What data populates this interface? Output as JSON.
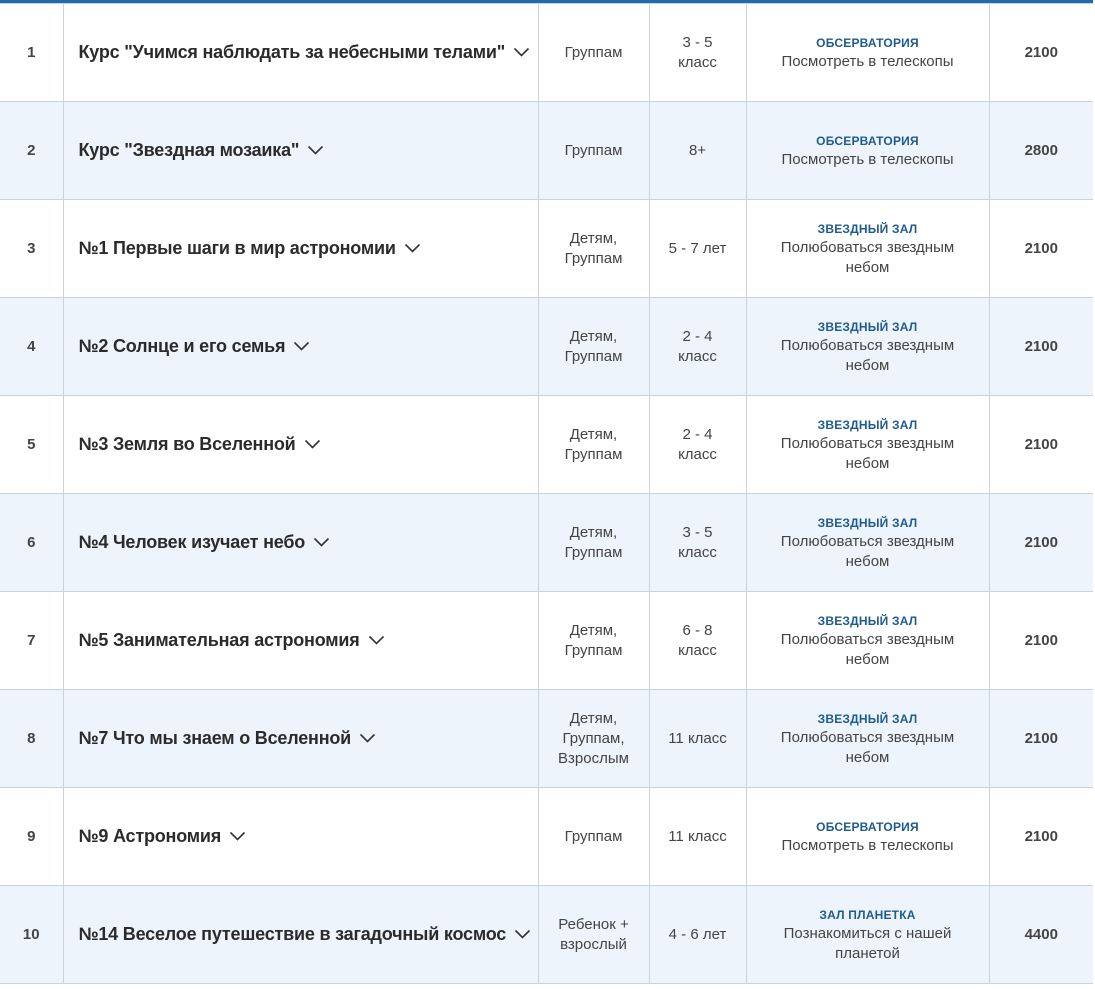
{
  "colors": {
    "accent_bar": "#1e6bb0",
    "price": "#3cb6a6",
    "hall_name": "#1f5b8e",
    "row_alt_bg": "#eef4fb",
    "border": "#c9d3de"
  },
  "icons": {
    "expand": "chevron-down-icon"
  },
  "rows": [
    {
      "num": "1",
      "title": "Курс \"Учимся наблюдать за небесными телами\"",
      "audience": [
        "Группам"
      ],
      "age": [
        "3 - 5",
        "класс"
      ],
      "hall_name": "ОБСЕРВАТОРИЯ",
      "hall_desc": [
        "Посмотреть в телескопы"
      ],
      "price": "2100"
    },
    {
      "num": "2",
      "title": "Курс \"Звездная мозаика\"",
      "audience": [
        "Группам"
      ],
      "age": [
        "8+"
      ],
      "hall_name": "ОБСЕРВАТОРИЯ",
      "hall_desc": [
        "Посмотреть в телескопы"
      ],
      "price": "2800"
    },
    {
      "num": "3",
      "title": "№1 Первые шаги в мир астрономии",
      "audience": [
        "Детям,",
        "Группам"
      ],
      "age": [
        "5 - 7 лет"
      ],
      "hall_name": "ЗВЕЗДНЫЙ ЗАЛ",
      "hall_desc": [
        "Полюбоваться звездным",
        "небом"
      ],
      "price": "2100"
    },
    {
      "num": "4",
      "title": "№2 Солнце и его семья",
      "audience": [
        "Детям,",
        "Группам"
      ],
      "age": [
        "2 - 4",
        "класс"
      ],
      "hall_name": "ЗВЕЗДНЫЙ ЗАЛ",
      "hall_desc": [
        "Полюбоваться звездным",
        "небом"
      ],
      "price": "2100"
    },
    {
      "num": "5",
      "title": "№3 Земля во Вселенной",
      "audience": [
        "Детям,",
        "Группам"
      ],
      "age": [
        "2 - 4",
        "класс"
      ],
      "hall_name": "ЗВЕЗДНЫЙ ЗАЛ",
      "hall_desc": [
        "Полюбоваться звездным",
        "небом"
      ],
      "price": "2100"
    },
    {
      "num": "6",
      "title": "№4 Человек изучает небо",
      "audience": [
        "Детям,",
        "Группам"
      ],
      "age": [
        "3 - 5",
        "класс"
      ],
      "hall_name": "ЗВЕЗДНЫЙ ЗАЛ",
      "hall_desc": [
        "Полюбоваться звездным",
        "небом"
      ],
      "price": "2100"
    },
    {
      "num": "7",
      "title": "№5 Занимательная астрономия",
      "audience": [
        "Детям,",
        "Группам"
      ],
      "age": [
        "6 - 8",
        "класс"
      ],
      "hall_name": "ЗВЕЗДНЫЙ ЗАЛ",
      "hall_desc": [
        "Полюбоваться звездным",
        "небом"
      ],
      "price": "2100"
    },
    {
      "num": "8",
      "title": "№7 Что мы знаем о Вселенной",
      "audience": [
        "Детям,",
        "Группам,",
        "Взрослым"
      ],
      "age": [
        "11 класс"
      ],
      "hall_name": "ЗВЕЗДНЫЙ ЗАЛ",
      "hall_desc": [
        "Полюбоваться звездным",
        "небом"
      ],
      "price": "2100"
    },
    {
      "num": "9",
      "title": "№9 Астрономия",
      "audience": [
        "Группам"
      ],
      "age": [
        "11 класс"
      ],
      "hall_name": "ОБСЕРВАТОРИЯ",
      "hall_desc": [
        "Посмотреть в телескопы"
      ],
      "price": "2100"
    },
    {
      "num": "10",
      "title": "№14 Веселое путешествие в загадочный космос",
      "audience": [
        "Ребенок +",
        "взрослый"
      ],
      "age": [
        "4 - 6 лет"
      ],
      "hall_name": "ЗАЛ ПЛАНЕТКА",
      "hall_desc": [
        "Познакомиться с нашей",
        "планетой"
      ],
      "price": "4400"
    }
  ]
}
